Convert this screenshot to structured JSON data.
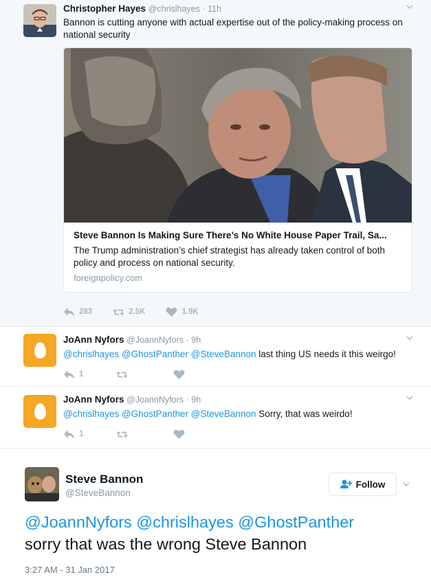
{
  "tweets": [
    {
      "name": "Christopher Hayes",
      "handle": "@chrislhayes",
      "time": "· 11h",
      "text": "Bannon is cutting anyone with actual expertise out of the policy-making process on national security",
      "card": {
        "title": "Steve Bannon Is Making Sure There’s No White House Paper Trail, Sa...",
        "description": "The Trump administration’s chief strategist has already taken control of both policy and process on national security.",
        "domain": "foreignpolicy.com"
      },
      "reply_count": "283",
      "retweet_count": "2.5K",
      "like_count": "1.9K"
    },
    {
      "name": "JoAnn Nyfors",
      "handle": "@JoannNyfors",
      "time": "· 9h",
      "mentions": "@chrislhayes @GhostPanther @SteveBannon",
      "text": " last thing US needs it this weirgo!",
      "reply_count": "1"
    },
    {
      "name": "JoAnn Nyfors",
      "handle": "@JoannNyfors",
      "time": "· 9h",
      "mentions": "@chrislhayes @GhostPanther @SteveBannon",
      "text": " Sorry, that was weirdo!",
      "reply_count": "1"
    }
  ],
  "main_tweet": {
    "name": "Steve Bannon",
    "handle": "@SteveBannon",
    "follow_label": "Follow",
    "mentions": "@JoannNyfors @chrislhayes @GhostPanther",
    "text": "sorry that was the wrong Steve Bannon",
    "timestamp": "3:27 AM - 31 Jan 2017"
  },
  "icons": {
    "reply": "reply-icon",
    "retweet": "retweet-icon",
    "like": "heart-icon",
    "caret": "chevron-down-icon",
    "follow": "add-user-icon"
  },
  "colors": {
    "link": "#1b95e0",
    "muted": "#8899a6",
    "action": "#aab8c2",
    "egg": "#f5a623"
  }
}
